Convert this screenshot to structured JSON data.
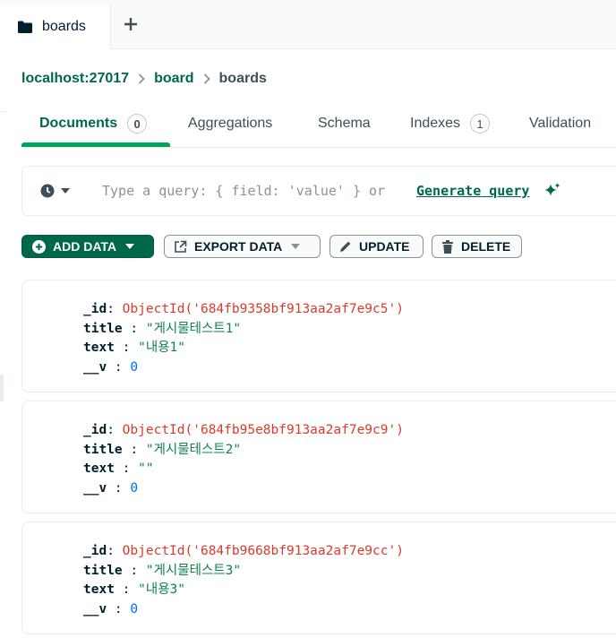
{
  "tab": {
    "label": "boards",
    "add_symbol": "+"
  },
  "breadcrumb": [
    "localhost:27017",
    "board",
    "boards"
  ],
  "view_tabs": [
    {
      "label": "Documents",
      "count": "0",
      "active": true
    },
    {
      "label": "Aggregations"
    },
    {
      "label": "Schema"
    },
    {
      "label": "Indexes",
      "count": "1"
    },
    {
      "label": "Validation"
    }
  ],
  "query": {
    "placeholder": "Type a query: { field: 'value' } or",
    "generate_label": "Generate query"
  },
  "actions": {
    "add_data": "ADD DATA",
    "export_data": "EXPORT DATA",
    "update": "UPDATE",
    "delete": "DELETE"
  },
  "colors": {
    "brand": "#00684a",
    "accent": "#00a35c",
    "objectid": "#db3b2a",
    "string": "#12824d",
    "number": "#016bf8"
  },
  "documents": [
    {
      "id_key": "_id",
      "id_value": "ObjectId('684fb9358bf913aa2af7e9c5')",
      "title_key": "title",
      "title_value": "\"게시물테스트1\"",
      "text_key": "text",
      "text_value": "\"내용1\"",
      "v_key": "__v",
      "v_value": "0"
    },
    {
      "id_key": "_id",
      "id_value": "ObjectId('684fb95e8bf913aa2af7e9c9')",
      "title_key": "title",
      "title_value": "\"게시물테스트2\"",
      "text_key": "text",
      "text_value": "\"\"",
      "v_key": "__v",
      "v_value": "0"
    },
    {
      "id_key": "_id",
      "id_value": "ObjectId('684fb9668bf913aa2af7e9cc')",
      "title_key": "title",
      "title_value": "\"게시물테스트3\"",
      "text_key": "text",
      "text_value": "\"내용3\"",
      "v_key": "__v",
      "v_value": "0"
    }
  ]
}
